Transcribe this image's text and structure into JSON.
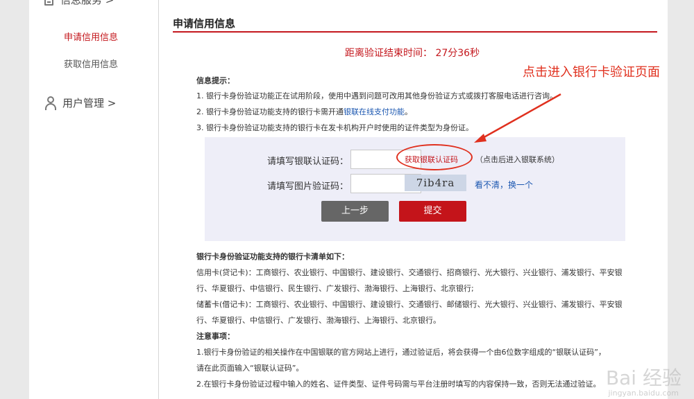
{
  "sidebar": {
    "header": "信息服务 >",
    "items": [
      {
        "label": "申请信用信息",
        "active": true
      },
      {
        "label": "获取信用信息",
        "active": false
      }
    ],
    "user_management": "用户管理 >"
  },
  "main": {
    "section_title": "申请信用信息",
    "timer": "距离验证结束时间： 27分36秒",
    "annotation": "点击进入银行卡验证页面",
    "tips": {
      "title": "信息提示：",
      "line1": "1. 银行卡身份验证功能正在试用阶段，使用中遇到问题可改用其他身份验证方式或拨打客服电话进行咨询。",
      "line2_prefix": "2. 银行卡身份验证功能支持的银行卡需开通",
      "line2_link": "银联在线支付功能",
      "line2_suffix": "。",
      "line3": "3. 银行卡身份验证功能支持的银行卡在发卡机构开户时使用的证件类型为身份证。"
    },
    "form": {
      "unionpay_label": "请填写银联认证码：",
      "get_code_link": "获取银联认证码",
      "get_code_hint": "（点击后进入银联系统）",
      "captcha_label": "请填写图片验证码：",
      "captcha_text": "7ib4ra",
      "refresh_link": "看不清，换一个",
      "prev_button": "上一步",
      "submit_button": "提交"
    },
    "banks": {
      "title": "银行卡身份验证功能支持的银行卡清单如下：",
      "credit_1": "信用卡(贷记卡)：工商银行、农业银行、中国银行、建设银行、交通银行、招商银行、光大银行、兴业银行、浦发银行、平安银",
      "credit_2": "行、华夏银行、中信银行、民生银行、广发银行、渤海银行、上海银行、北京银行;",
      "debit_1": "储蓄卡(借记卡)：工商银行、农业银行、中国银行、建设银行、交通银行、邮储银行、光大银行、兴业银行、浦发银行、平安银",
      "debit_2": "行、华夏银行、中信银行、广发银行、渤海银行、上海银行、北京银行。",
      "notes_title": "注意事项：",
      "note1": "1.银行卡身份验证的相关操作在中国银联的官方网站上进行，通过验证后，将会获得一个由6位数字组成的“银联认证码”，",
      "note1_cont": "请在此页面输入“银联认证码”。",
      "note2": "2.在银行卡身份验证过程中输入的姓名、证件类型、证件号码需与平台注册时填写的内容保持一致，否则无法通过验证。"
    }
  },
  "watermark": {
    "logo": "Bai 经验",
    "url": "jingyan.baidu.com"
  },
  "colors": {
    "brand_red": "#c4171d",
    "link_blue": "#1a56b0",
    "annotation_red": "#e0301e"
  }
}
